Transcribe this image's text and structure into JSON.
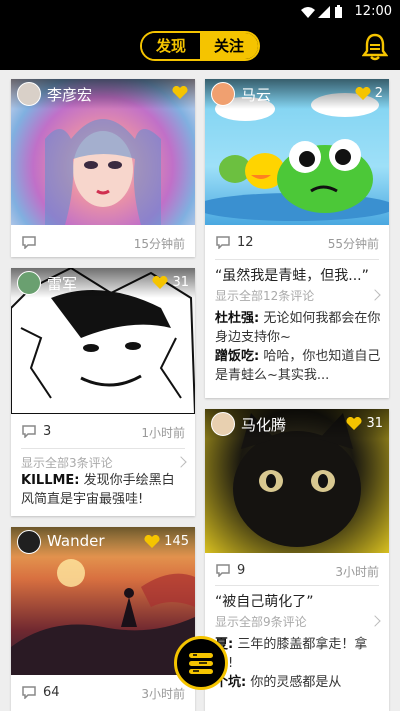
{
  "status": {
    "time": "12:00"
  },
  "tabs": {
    "discover": "发现",
    "follow": "关注"
  },
  "colors": {
    "accent": "#f5c400",
    "bar": "#000000"
  },
  "feed": {
    "c1": {
      "user": "李彦宏",
      "time": "15分钟前"
    },
    "c2": {
      "user": "雷军",
      "likes": "31",
      "comments": "3",
      "time": "1小时前",
      "show_all": "显示全部3条评论",
      "comment1_user": "KILLME:",
      "comment1_text": " 发现你手绘黑白风简直是宇宙最强哇!"
    },
    "c3": {
      "user": "Wander",
      "likes": "145",
      "comments": "64",
      "time": "3小时前"
    },
    "c4": {
      "user": "马云",
      "likes": "2",
      "comments": "12",
      "time": "55分钟前",
      "quote": "“虽然我是青蛙，但我...”",
      "show_all": "显示全部12条评论",
      "comment1_user": "杜杜强:",
      "comment1_text": " 无论如何我都会在你身边支持你~",
      "comment2_user": "蹭饭吃:",
      "comment2_text": " 哈哈，你也知道自己是青蛙么~其实我..."
    },
    "c5": {
      "user": "马化腾",
      "likes": "31",
      "comments": "9",
      "time": "3小时前",
      "quote": "“被自己萌化了”",
      "show_all": "显示全部9条评论",
      "comment1_user": "夏:",
      "comment1_text": " 三年的膝盖都拿走！拿走!",
      "comment2_user": "个坑:",
      "comment2_text": " 你的灵感都是从"
    }
  }
}
